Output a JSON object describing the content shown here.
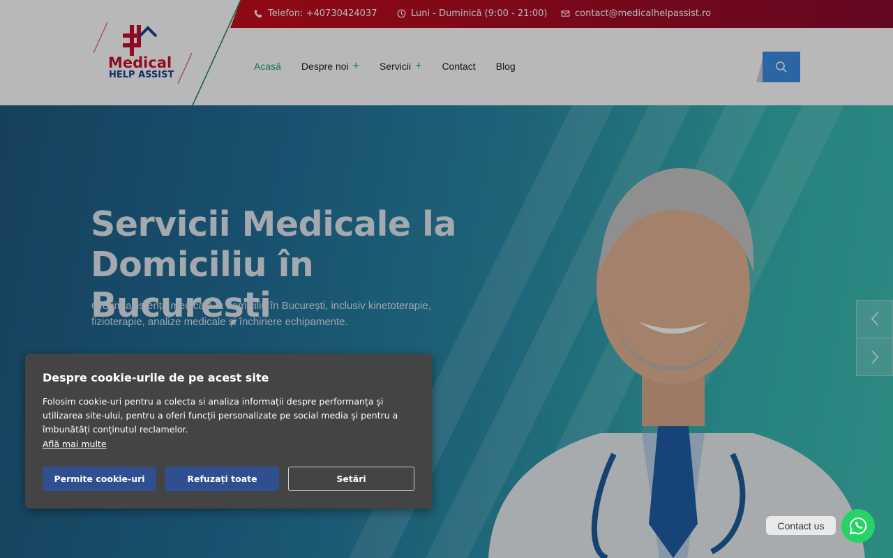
{
  "topbar": {
    "phone": "Telefon: +40730424037",
    "hours": "Luni - Duminică (9:00 - 21:00)",
    "email": "contact@medicalhelpassist.ro"
  },
  "logo": {
    "line1": "Medical",
    "line2": "HELP ASSIST"
  },
  "nav": {
    "items": [
      {
        "label": "Acasă",
        "active": true
      },
      {
        "label": "Despre noi",
        "dropdown": true
      },
      {
        "label": "Servicii",
        "dropdown": true
      },
      {
        "label": "Contact"
      },
      {
        "label": "Blog"
      }
    ]
  },
  "hero": {
    "title_line1": "Servicii Medicale la",
    "title_line2": "Domiciliu în București",
    "text": "Oferim asistență medicală la domiciliu în București, inclusiv kinetoterapie, fizioterapie, analize medicale și închiriere echipamente."
  },
  "cookie": {
    "title": "Despre cookie-urile de pe acest site",
    "text": "Folosim cookie-uri pentru a colecta si analiza informații despre performanța și utilizarea site-ului, pentru a oferi funcții personalizate pe social media și pentru a îmbunătăți conținutul reclamelor.",
    "link": "Află mai multe",
    "allow": "Permite cookie-uri",
    "refuse": "Refuzați toate",
    "settings": "Setări"
  },
  "contact": {
    "label": "Contact us"
  },
  "colors": {
    "brand_red": "#c8102e",
    "brand_blue": "#1f3e8c",
    "accent_green": "#20a37b",
    "search_blue": "#3d8ce2",
    "whatsapp": "#25d366"
  }
}
